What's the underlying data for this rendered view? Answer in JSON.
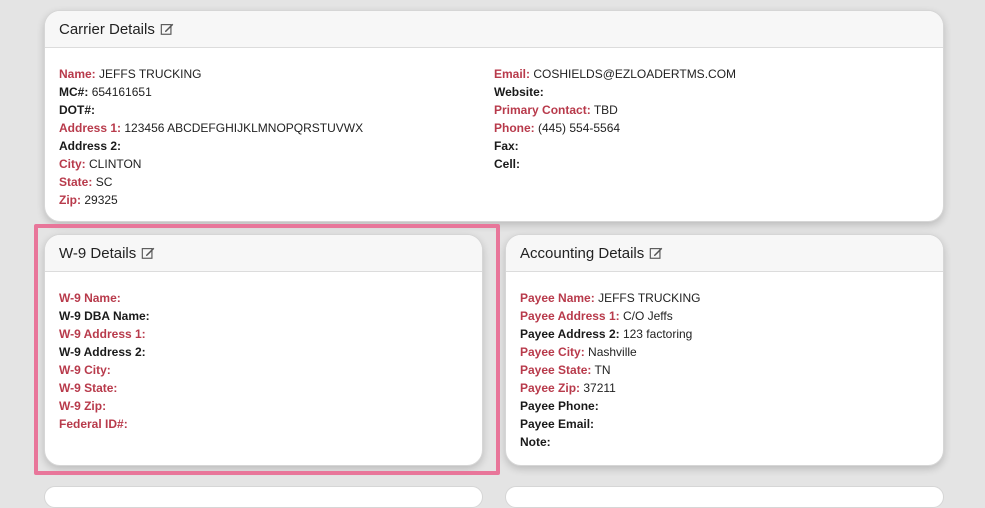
{
  "carrier": {
    "title": "Carrier Details",
    "left": [
      {
        "label": "Name:",
        "value": "JEFFS TRUCKING",
        "required": true
      },
      {
        "label": "MC#:",
        "value": "654161651",
        "required": false
      },
      {
        "label": "DOT#:",
        "value": "",
        "required": false
      },
      {
        "label": "Address 1:",
        "value": "123456 ABCDEFGHIJKLMNOPQRSTUVWX",
        "required": true
      },
      {
        "label": "Address 2:",
        "value": "",
        "required": false
      },
      {
        "label": "City:",
        "value": "CLINTON",
        "required": true
      },
      {
        "label": "State:",
        "value": "SC",
        "required": true
      },
      {
        "label": "Zip:",
        "value": "29325",
        "required": true
      }
    ],
    "right": [
      {
        "label": "Email:",
        "value": "COSHIELDS@EZLOADERTMS.COM",
        "required": true
      },
      {
        "label": "Website:",
        "value": "",
        "required": false
      },
      {
        "label": "Primary Contact:",
        "value": "TBD",
        "required": true
      },
      {
        "label": "Phone:",
        "value": "(445) 554-5564",
        "required": true
      },
      {
        "label": "Fax:",
        "value": "",
        "required": false
      },
      {
        "label": "Cell:",
        "value": "",
        "required": false
      }
    ]
  },
  "w9": {
    "title": "W-9 Details",
    "rows": [
      {
        "label": "W-9 Name:",
        "value": "",
        "required": true
      },
      {
        "label": "W-9 DBA Name:",
        "value": "",
        "required": false
      },
      {
        "label": "W-9 Address 1:",
        "value": "",
        "required": true
      },
      {
        "label": "W-9 Address 2:",
        "value": "",
        "required": false
      },
      {
        "label": "W-9 City:",
        "value": "",
        "required": true
      },
      {
        "label": "W-9 State:",
        "value": "",
        "required": true
      },
      {
        "label": "W-9 Zip:",
        "value": "",
        "required": true
      },
      {
        "label": "Federal ID#:",
        "value": "",
        "required": true
      }
    ]
  },
  "accounting": {
    "title": "Accounting Details",
    "rows": [
      {
        "label": "Payee Name:",
        "value": "JEFFS TRUCKING",
        "required": true
      },
      {
        "label": "Payee Address 1:",
        "value": "C/O Jeffs",
        "required": true
      },
      {
        "label": "Payee Address 2:",
        "value": "123 factoring",
        "required": false
      },
      {
        "label": "Payee City:",
        "value": "Nashville",
        "required": true
      },
      {
        "label": "Payee State:",
        "value": "TN",
        "required": true
      },
      {
        "label": "Payee Zip:",
        "value": "37211",
        "required": true
      },
      {
        "label": "Payee Phone:",
        "value": "",
        "required": false
      },
      {
        "label": "Payee Email:",
        "value": "",
        "required": false
      },
      {
        "label": "Note:",
        "value": "",
        "required": false
      }
    ]
  },
  "colors": {
    "required_label": "#b83a4b",
    "highlight_border": "#e8769a",
    "page_background": "#e4e4e4"
  },
  "icons": {
    "edit": "edit-icon"
  }
}
